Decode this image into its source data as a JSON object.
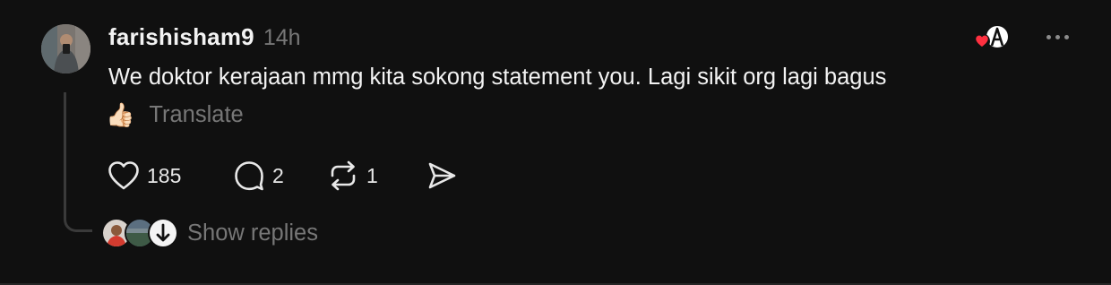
{
  "post": {
    "username": "farishisham9",
    "time": "14h",
    "text": "We doktor kerajaan mmg kita sokong statement you. Lagi sikit org lagi bagus",
    "emoji": "👍🏻",
    "translate_label": "Translate",
    "actions": {
      "like_count": "185",
      "reply_count": "2",
      "repost_count": "1"
    },
    "show_replies_label": "Show replies"
  },
  "icons": {
    "like": "heart-icon",
    "reply": "comment-bubble-icon",
    "repost": "repost-arrows-icon",
    "share": "send-icon",
    "more": "more-dots-icon",
    "liked_by_author": "author-like-badge-icon"
  },
  "colors": {
    "background": "#101010",
    "text_primary": "#f3f3f3",
    "text_secondary": "#777777",
    "heart_badge": "#ff3040",
    "thread_line": "#3a3a3a"
  }
}
